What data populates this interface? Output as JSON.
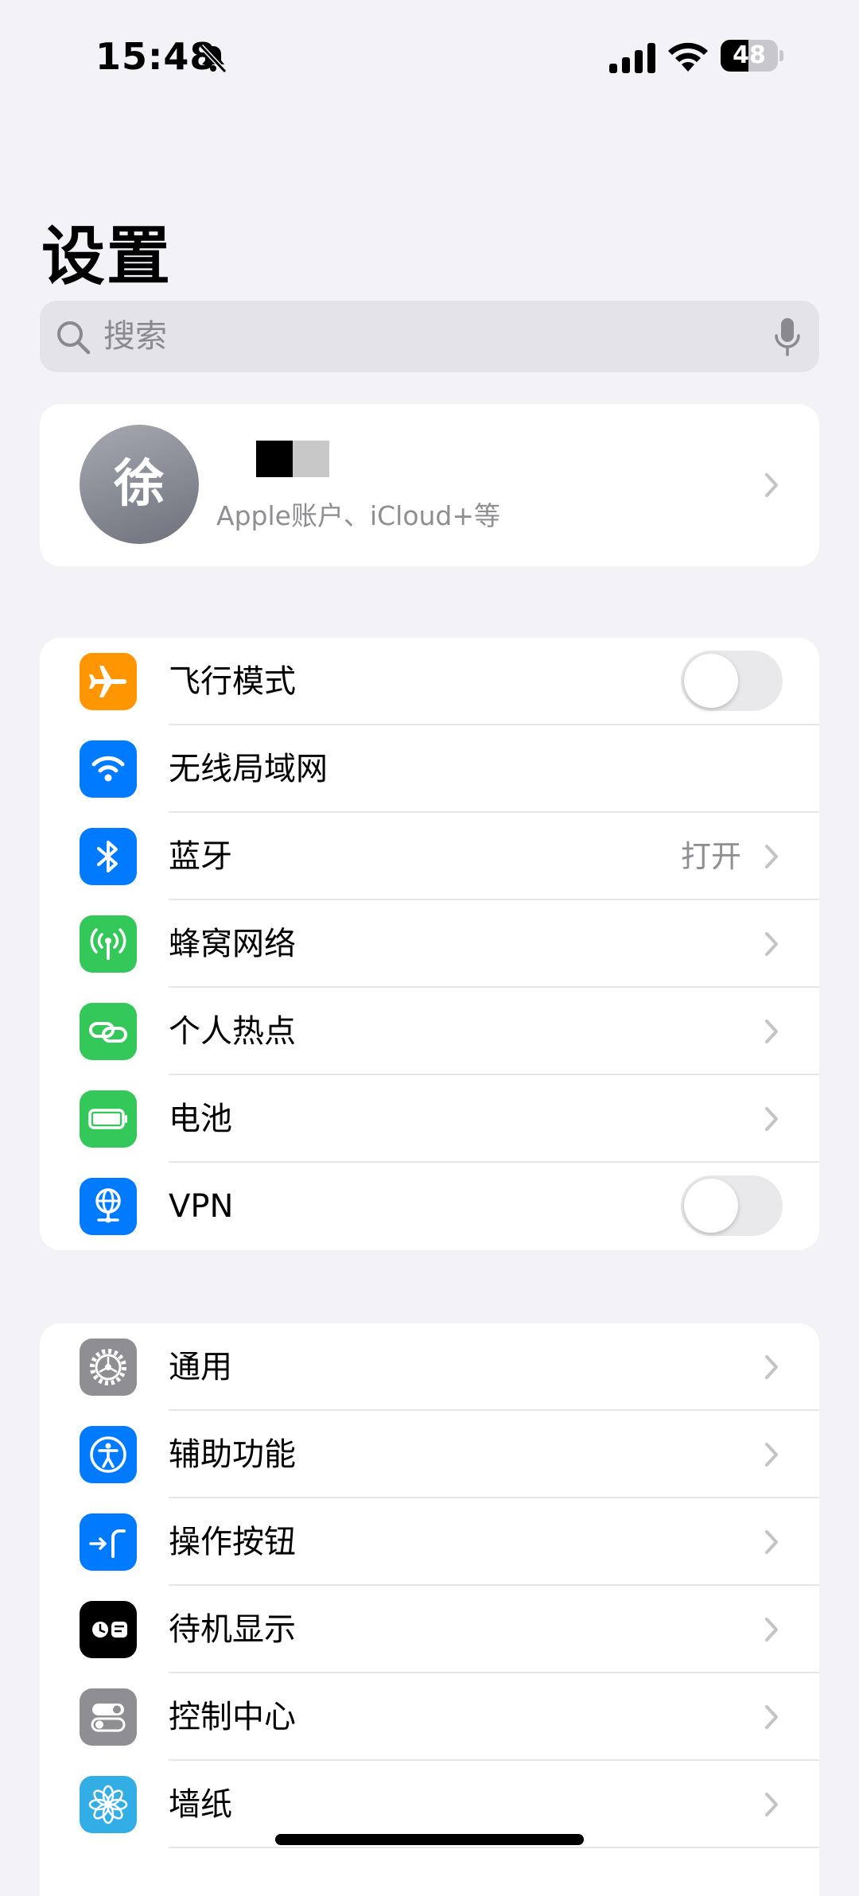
{
  "status_bar": {
    "time": "15:48",
    "battery": "48",
    "battery_level": 0.48
  },
  "page_title": "设置",
  "search": {
    "placeholder": "搜索"
  },
  "profile": {
    "avatar_char": "徐",
    "subtitle": "Apple账户、iCloud+等"
  },
  "connectivity": [
    {
      "label": "飞行模式",
      "icon": "airplane-icon",
      "accessory": "toggle",
      "toggle_on": false,
      "color": "#ff9500"
    },
    {
      "label": "无线局域网",
      "icon": "wifi-icon",
      "accessory": "none",
      "color": "#007aff"
    },
    {
      "label": "蓝牙",
      "icon": "bluetooth-icon",
      "accessory": "chevron",
      "value": "打开",
      "color": "#007aff"
    },
    {
      "label": "蜂窝网络",
      "icon": "antenna-icon",
      "accessory": "chevron",
      "color": "#34c759"
    },
    {
      "label": "个人热点",
      "icon": "hotspot-link-icon",
      "accessory": "chevron",
      "color": "#34c759"
    },
    {
      "label": "电池",
      "icon": "battery-icon",
      "accessory": "chevron",
      "color": "#34c759"
    },
    {
      "label": "VPN",
      "icon": "vpn-globe-icon",
      "accessory": "toggle",
      "toggle_on": false,
      "color": "#007aff"
    }
  ],
  "general": [
    {
      "label": "通用",
      "icon": "gear-icon",
      "color": "#8e8e93"
    },
    {
      "label": "辅助功能",
      "icon": "accessibility-icon",
      "color": "#007aff"
    },
    {
      "label": "操作按钮",
      "icon": "action-button-icon",
      "color": "#007aff"
    },
    {
      "label": "待机显示",
      "icon": "standby-icon",
      "color": "#000000"
    },
    {
      "label": "控制中心",
      "icon": "control-center-icon",
      "color": "#8e8e93"
    },
    {
      "label": "墙纸",
      "icon": "flower-icon",
      "color": "#32ade6"
    }
  ]
}
